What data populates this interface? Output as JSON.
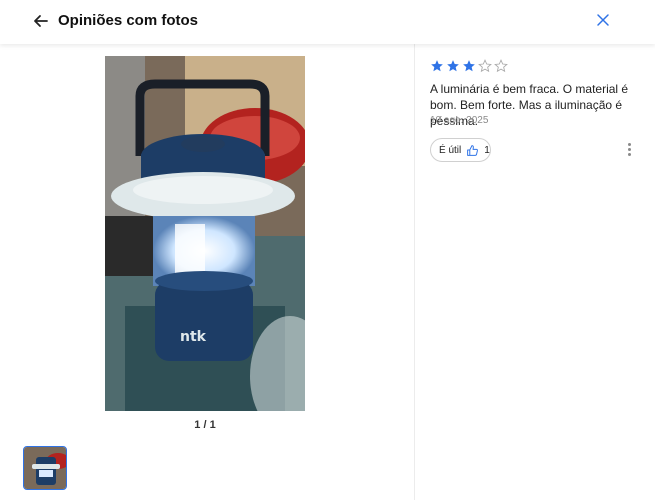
{
  "header": {
    "title": "Opiniões com fotos",
    "back_icon": "arrow-left-icon",
    "close_icon": "close-icon",
    "accent_color": "#2f73e6"
  },
  "gallery": {
    "counter": "1 / 1",
    "photo_description_icon": "lantern-photo",
    "product_brand_on_photo": "ntk"
  },
  "review": {
    "rating": 3,
    "max_rating": 5,
    "star_color": "#2f73e6",
    "text": "A luminária é bem fraca. O material é bom. Bem forte. Mas a iluminação é péssima.",
    "date": "10 ago. 2025",
    "useful_label": "É útil",
    "useful_count": "1",
    "more_icon": "more-vertical-icon"
  }
}
